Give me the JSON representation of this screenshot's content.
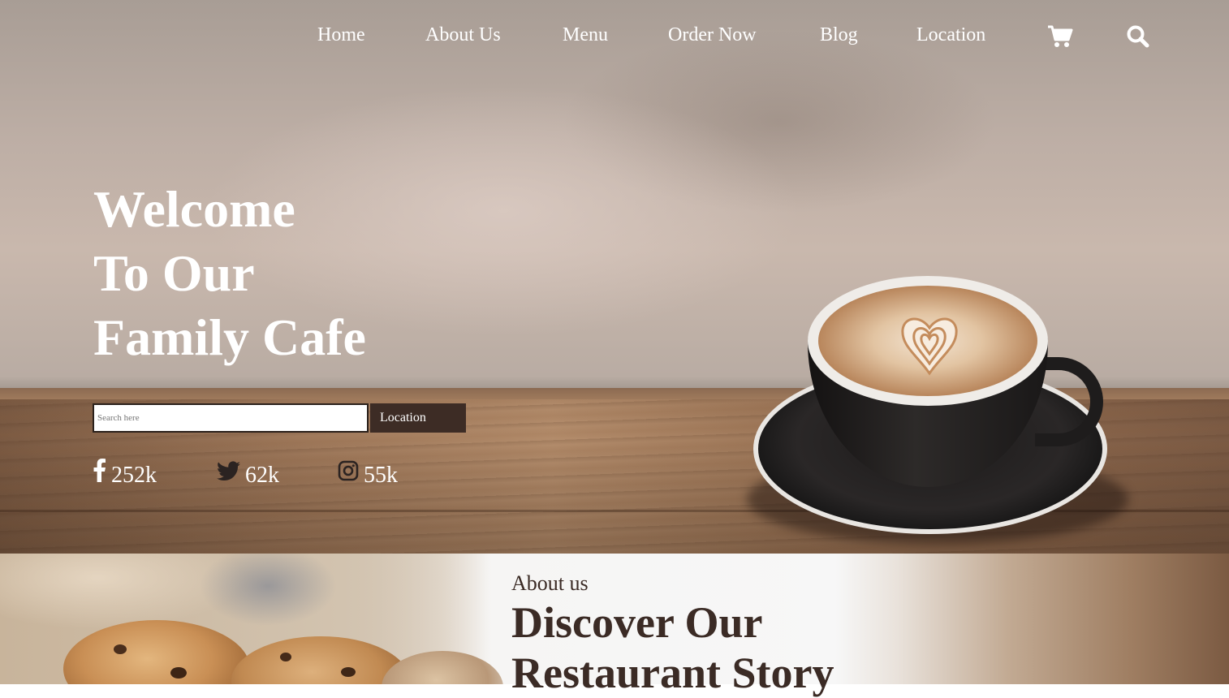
{
  "nav": {
    "items": [
      "Home",
      "About Us",
      "Menu",
      "Order Now",
      "Blog",
      "Location"
    ],
    "cart_icon": "cart-icon",
    "search_icon": "search-icon"
  },
  "hero": {
    "title_lines": [
      "Welcome",
      "To Our",
      "Family Cafe"
    ],
    "search_placeholder": "Search here",
    "search_button": "Location",
    "social": [
      {
        "icon": "facebook-icon",
        "count": "252k"
      },
      {
        "icon": "twitter-icon",
        "count": "62k"
      },
      {
        "icon": "instagram-icon",
        "count": "55k"
      }
    ]
  },
  "about": {
    "label": "About us",
    "title_lines": [
      "Discover Our",
      "Restaurant Story"
    ]
  },
  "colors": {
    "brown_dark": "#3d2c25",
    "text_dark": "#3a2a24",
    "white": "#ffffff"
  }
}
